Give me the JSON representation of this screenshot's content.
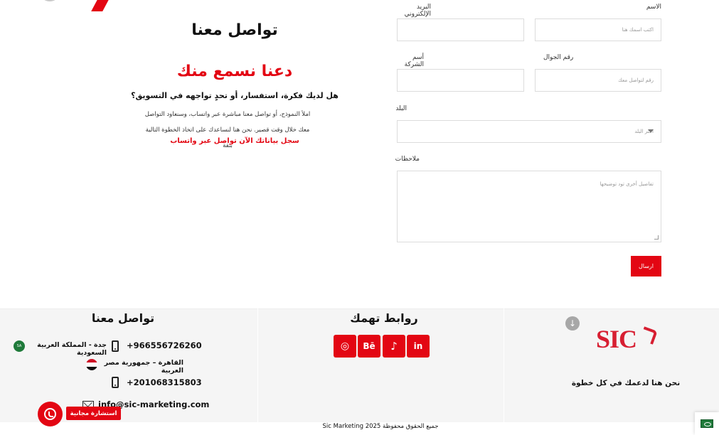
{
  "intro": {
    "title": "تواصل معنا",
    "headline": "دعنا نسمع منك",
    "question": "هل لديك فكرة، استفسار، أو تحدٍ تواجهه في التسويق؟",
    "desc_line1": "املأ النموذج، أو تواصل معنا مباشرة عبر واتساب، وسنعاود التواصل",
    "desc_line2": "معك خلال وقت قصير. نحن هنا لنساعدك على اتخاذ الخطوة التالية بثقة",
    "cta": "سجل بياناتك الآن تواصل عبر واتساب"
  },
  "form": {
    "name_label": "الاسم",
    "name_placeholder": "اكتب اسمك هنا",
    "email_label": "البريد الإلكتروني",
    "email_placeholder": "",
    "phone_label": "رقم الجوال",
    "phone_placeholder": "رقم لتواصل معك",
    "company_label": "أسم الشركة",
    "company_placeholder": "",
    "country_label": "البلد",
    "country_placeholder": "اختر البلد",
    "notes_label": "ملاحظات",
    "notes_placeholder": "تفاصيل أخرى تود توضيحها",
    "submit_label": "ارسال"
  },
  "footer": {
    "contact_title": "تواصل معنا",
    "phone_sa": "+966556726260",
    "location_sa": "جدة - المملكة العربية السعودية",
    "location_eg": "القاهرة – جمهورية مصر العربية",
    "phone_eg": "+201068315803",
    "email": "info@sic-marketing.com",
    "links_title": "روابط تهمك",
    "social": [
      {
        "icon": "instagram-icon",
        "glyph": "◎"
      },
      {
        "icon": "behance-icon",
        "glyph": "Bē"
      },
      {
        "icon": "tiktok-icon",
        "glyph": "♪"
      },
      {
        "icon": "linkedin-icon",
        "glyph": "in"
      }
    ],
    "logo_text": "SIC",
    "tagline": "نحن هنا لدعمك في كل خطوة",
    "copyright": "جميع الحقوق محفوظة Sic Marketing 2025"
  },
  "widgets": {
    "consult_label": "استشارة مجانية",
    "flag_sa_text": "SA"
  },
  "colors": {
    "brand_red": "#e30613",
    "footer_bg": "#f5f5f5"
  }
}
